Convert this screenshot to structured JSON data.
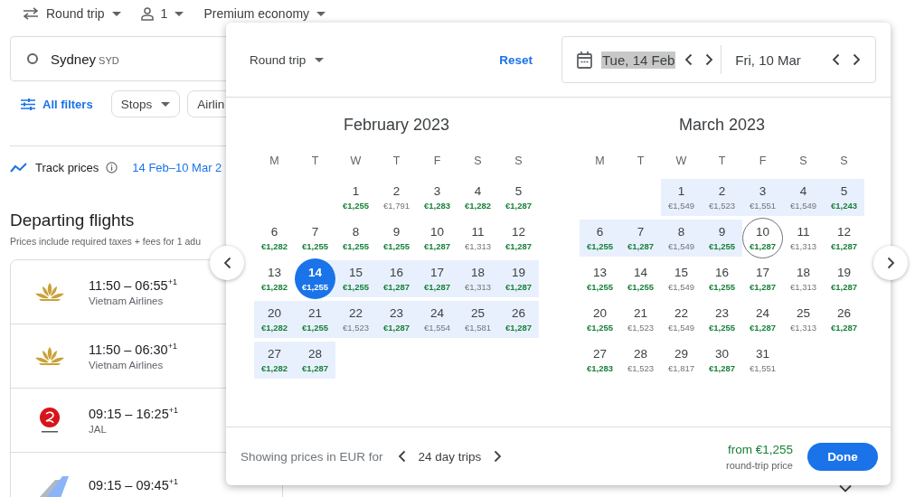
{
  "top_bar": {
    "trip_type": "Round trip",
    "passengers": "1",
    "cabin": "Premium economy"
  },
  "search": {
    "origin": "Sydney",
    "origin_code": "SYD"
  },
  "filters": {
    "all_filters": "All filters",
    "chips": [
      "Stops",
      "Airlin"
    ]
  },
  "tracking": {
    "label": "Track prices",
    "dates": "14 Feb–10 Mar 2"
  },
  "results": {
    "title": "Departing flights",
    "subtitle": "Prices include required taxes + fees for 1 adu",
    "flights": [
      {
        "kind": "lotus",
        "times": "11:50 – 06:55",
        "day_offset": "+1",
        "airline": "Vietnam Airlines"
      },
      {
        "kind": "lotus",
        "times": "11:50 – 06:30",
        "day_offset": "+1",
        "airline": "Vietnam Airlines"
      },
      {
        "kind": "crane",
        "times": "09:15 – 16:25",
        "day_offset": "+1",
        "airline": "JAL"
      },
      {
        "kind": "tail",
        "times": "09:15 – 09:45",
        "day_offset": "+1"
      }
    ]
  },
  "date_picker": {
    "trip_type": "Round trip",
    "reset": "Reset",
    "dates": [
      {
        "label": "Tue, 14 Feb",
        "selected": true
      },
      {
        "label": "Fri, 10 Mar",
        "selected": false
      }
    ],
    "months": [
      {
        "title": "February 2023",
        "weekdays": [
          "M",
          "T",
          "W",
          "T",
          "F",
          "S",
          "S"
        ],
        "weeks": [
          {
            "kind": "first",
            "days": [
              {
                "day": "1",
                "price": "€1,255",
                "cheap": true,
                "in_range": false,
                "selected": false
              },
              {
                "day": "2",
                "price": "€1,791",
                "cheap": false,
                "in_range": false,
                "selected": false
              },
              {
                "day": "3",
                "price": "€1,283",
                "cheap": true,
                "in_range": false,
                "selected": false
              },
              {
                "day": "4",
                "price": "€1,282",
                "cheap": true,
                "in_range": false,
                "selected": false
              },
              {
                "day": "5",
                "price": "€1,287",
                "cheap": true,
                "in_range": false,
                "selected": false
              }
            ]
          },
          {
            "kind": "full",
            "days": [
              {
                "day": "6",
                "price": "€1,282",
                "cheap": true,
                "in_range": false,
                "selected": false
              },
              {
                "day": "7",
                "price": "€1,255",
                "cheap": true,
                "in_range": false,
                "selected": false
              },
              {
                "day": "8",
                "price": "€1,255",
                "cheap": true,
                "in_range": false,
                "selected": false
              },
              {
                "day": "9",
                "price": "€1,255",
                "cheap": true,
                "in_range": false,
                "selected": false
              },
              {
                "day": "10",
                "price": "€1,287",
                "cheap": true,
                "in_range": false,
                "selected": false
              },
              {
                "day": "11",
                "price": "€1,313",
                "cheap": false,
                "in_range": false,
                "selected": false
              },
              {
                "day": "12",
                "price": "€1,287",
                "cheap": true,
                "in_range": false,
                "selected": false
              }
            ]
          },
          {
            "kind": "full",
            "days": [
              {
                "day": "13",
                "price": "€1,282",
                "cheap": true,
                "in_range": false,
                "selected": false
              },
              {
                "day": "14",
                "price": "€1,255",
                "cheap": true,
                "in_range": true,
                "selected": true
              },
              {
                "day": "15",
                "price": "€1,255",
                "cheap": true,
                "in_range": true,
                "selected": false
              },
              {
                "day": "16",
                "price": "€1,287",
                "cheap": true,
                "in_range": true,
                "selected": false
              },
              {
                "day": "17",
                "price": "€1,287",
                "cheap": true,
                "in_range": true,
                "selected": false
              },
              {
                "day": "18",
                "price": "€1,313",
                "cheap": false,
                "in_range": true,
                "selected": false
              },
              {
                "day": "19",
                "price": "€1,287",
                "cheap": true,
                "in_range": true,
                "selected": false
              }
            ]
          },
          {
            "kind": "full",
            "days": [
              {
                "day": "20",
                "price": "€1,282",
                "cheap": true,
                "in_range": true,
                "selected": false
              },
              {
                "day": "21",
                "price": "€1,255",
                "cheap": true,
                "in_range": true,
                "selected": false
              },
              {
                "day": "22",
                "price": "€1,523",
                "cheap": false,
                "in_range": true,
                "selected": false
              },
              {
                "day": "23",
                "price": "€1,287",
                "cheap": true,
                "in_range": true,
                "selected": false
              },
              {
                "day": "24",
                "price": "€1,554",
                "cheap": false,
                "in_range": true,
                "selected": false
              },
              {
                "day": "25",
                "price": "€1,581",
                "cheap": false,
                "in_range": true,
                "selected": false
              },
              {
                "day": "26",
                "price": "€1,287",
                "cheap": true,
                "in_range": true,
                "selected": false
              }
            ]
          },
          {
            "kind": "last",
            "days": [
              {
                "day": "27",
                "price": "€1,282",
                "cheap": true,
                "in_range": true,
                "selected": false
              },
              {
                "day": "28",
                "price": "€1,287",
                "cheap": true,
                "in_range": true,
                "selected": false
              }
            ]
          }
        ]
      },
      {
        "title": "March 2023",
        "weekdays": [
          "M",
          "T",
          "W",
          "T",
          "F",
          "S",
          "S"
        ],
        "weeks": [
          {
            "kind": "first",
            "days": [
              {
                "day": "1",
                "price": "€1,549",
                "cheap": false,
                "in_range": true,
                "selected": false
              },
              {
                "day": "2",
                "price": "€1,523",
                "cheap": false,
                "in_range": true,
                "selected": false
              },
              {
                "day": "3",
                "price": "€1,551",
                "cheap": false,
                "in_range": true,
                "selected": false
              },
              {
                "day": "4",
                "price": "€1,549",
                "cheap": false,
                "in_range": true,
                "selected": false
              },
              {
                "day": "5",
                "price": "€1,243",
                "cheap": true,
                "in_range": true,
                "selected": false
              }
            ]
          },
          {
            "kind": "full",
            "days": [
              {
                "day": "6",
                "price": "€1,255",
                "cheap": true,
                "in_range": true,
                "selected": false
              },
              {
                "day": "7",
                "price": "€1,287",
                "cheap": true,
                "in_range": true,
                "selected": false
              },
              {
                "day": "8",
                "price": "€1,549",
                "cheap": false,
                "in_range": true,
                "selected": false
              },
              {
                "day": "9",
                "price": "€1,255",
                "cheap": true,
                "in_range": true,
                "selected": false
              },
              {
                "day": "10",
                "price": "€1,287",
                "cheap": true,
                "in_range": false,
                "selected": true
              },
              {
                "day": "11",
                "price": "€1,313",
                "cheap": false,
                "in_range": false,
                "selected": false
              },
              {
                "day": "12",
                "price": "€1,287",
                "cheap": true,
                "in_range": false,
                "selected": false
              }
            ]
          },
          {
            "kind": "full",
            "days": [
              {
                "day": "13",
                "price": "€1,255",
                "cheap": true,
                "in_range": false,
                "selected": false
              },
              {
                "day": "14",
                "price": "€1,255",
                "cheap": true,
                "in_range": false,
                "selected": false
              },
              {
                "day": "15",
                "price": "€1,549",
                "cheap": false,
                "in_range": false,
                "selected": false
              },
              {
                "day": "16",
                "price": "€1,255",
                "cheap": true,
                "in_range": false,
                "selected": false
              },
              {
                "day": "17",
                "price": "€1,287",
                "cheap": true,
                "in_range": false,
                "selected": false
              },
              {
                "day": "18",
                "price": "€1,313",
                "cheap": false,
                "in_range": false,
                "selected": false
              },
              {
                "day": "19",
                "price": "€1,287",
                "cheap": true,
                "in_range": false,
                "selected": false
              }
            ]
          },
          {
            "kind": "full",
            "days": [
              {
                "day": "20",
                "price": "€1,255",
                "cheap": true,
                "in_range": false,
                "selected": false
              },
              {
                "day": "21",
                "price": "€1,523",
                "cheap": false,
                "in_range": false,
                "selected": false
              },
              {
                "day": "22",
                "price": "€1,549",
                "cheap": false,
                "in_range": false,
                "selected": false
              },
              {
                "day": "23",
                "price": "€1,255",
                "cheap": true,
                "in_range": false,
                "selected": false
              },
              {
                "day": "24",
                "price": "€1,287",
                "cheap": true,
                "in_range": false,
                "selected": false
              },
              {
                "day": "25",
                "price": "€1,313",
                "cheap": false,
                "in_range": false,
                "selected": false
              },
              {
                "day": "26",
                "price": "€1,287",
                "cheap": true,
                "in_range": false,
                "selected": false
              }
            ]
          },
          {
            "kind": "last",
            "days": [
              {
                "day": "27",
                "price": "€1,283",
                "cheap": true,
                "in_range": false,
                "selected": false
              },
              {
                "day": "28",
                "price": "€1,523",
                "cheap": false,
                "in_range": false,
                "selected": false
              },
              {
                "day": "29",
                "price": "€1,817",
                "cheap": false,
                "in_range": false,
                "selected": false
              },
              {
                "day": "30",
                "price": "€1,287",
                "cheap": true,
                "in_range": false,
                "selected": false
              },
              {
                "day": "31",
                "price": "€1,551",
                "cheap": false,
                "in_range": false,
                "selected": false
              }
            ]
          }
        ]
      }
    ],
    "footer": {
      "note": "Showing prices in EUR for",
      "trip_length": "24 day trips",
      "from_price": "from €1,255",
      "price_note": "round-trip price",
      "done": "Done"
    }
  }
}
